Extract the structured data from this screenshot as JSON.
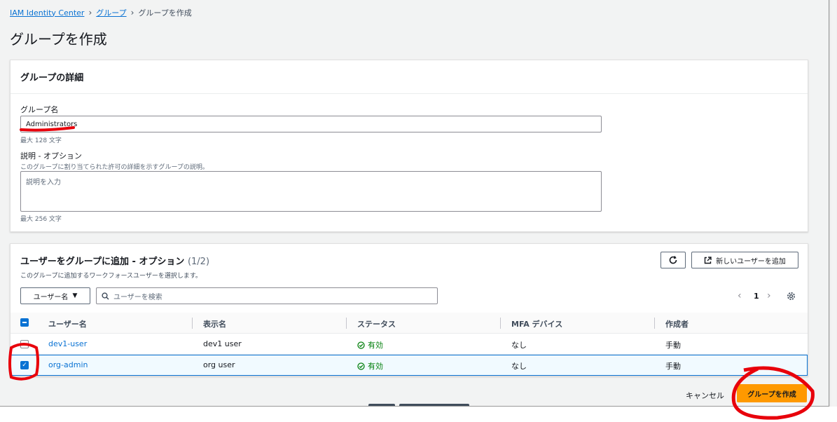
{
  "breadcrumb": {
    "root": "IAM Identity Center",
    "parent": "グループ",
    "current": "グループを作成"
  },
  "page_title": "グループを作成",
  "details": {
    "header": "グループの詳細",
    "group_name_label": "グループ名",
    "group_name_value": "Administrators",
    "group_name_hint": "最大 128 文字",
    "description_label": "説明 - オプション",
    "description_sub": "このグループに割り当てられた許可の詳細を示すグループの説明。",
    "description_placeholder": "説明を入力",
    "description_hint": "最大 256 文字"
  },
  "users": {
    "title": "ユーザーをグループに追加 - オプション",
    "count": "(1/2)",
    "description": "このグループに追加するワークフォースユーザーを選択します。",
    "refresh_icon": "refresh-icon",
    "new_user_button": "新しいユーザーを追加",
    "filter_dropdown": "ユーザー名",
    "search_placeholder": "ユーザーを検索",
    "page_number": "1",
    "columns": [
      "ユーザー名",
      "表示名",
      "ステータス",
      "MFA デバイス",
      "作成者"
    ],
    "rows": [
      {
        "username": "dev1-user",
        "display_name": "dev1 user",
        "status": "有効",
        "mfa": "なし",
        "created_by": "手動",
        "checked": false
      },
      {
        "username": "org-admin",
        "display_name": "org user",
        "status": "有効",
        "mfa": "なし",
        "created_by": "手動",
        "checked": true
      }
    ]
  },
  "footer": {
    "cancel": "キャンセル",
    "create": "グループを作成"
  },
  "colors": {
    "link": "#0972d3",
    "primary_button": "#ff9900",
    "status_ok": "#037f0c",
    "annotation": "#e8000b"
  }
}
